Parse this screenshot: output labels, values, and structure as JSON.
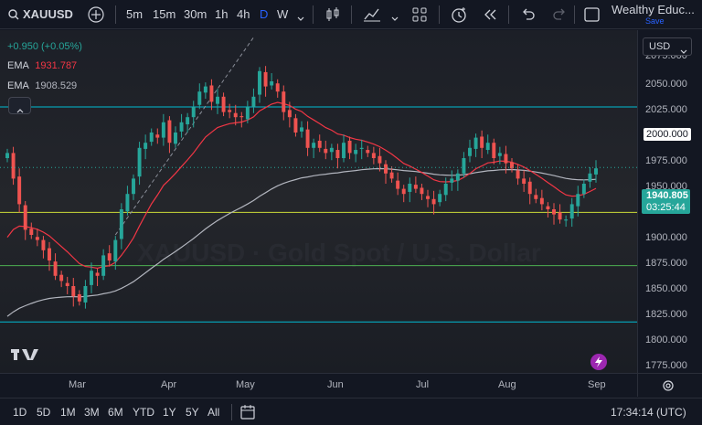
{
  "toolbar": {
    "symbol": "XAUUSD",
    "add_symbol_icon": "plus-circle-icon",
    "timeframes": [
      "5m",
      "15m",
      "30m",
      "1h",
      "4h",
      "D",
      "W"
    ],
    "active_timeframe": "D",
    "account_name": "Wealthy Educ...",
    "save_label": "Save"
  },
  "legend": {
    "change": "+0.950 (+0.05%)",
    "ema1_label": "EMA",
    "ema1_value": "1931.787",
    "ema2_label": "EMA",
    "ema2_value": "1908.529",
    "collapse_icon": "chevron-up-icon"
  },
  "currency": "USD",
  "price_axis": {
    "top_partial": "2075.000",
    "ticks": [
      "2050.000",
      "2025.000",
      "2000.000",
      "1975.000",
      "1950.000",
      "1925.000",
      "1900.000",
      "1875.000",
      "1850.000",
      "1825.000",
      "1800.000",
      "1775.000"
    ],
    "current_price": "1940.805",
    "countdown": "03:25:44",
    "level_label": "2000.000"
  },
  "time_axis": {
    "ticks": [
      "Mar",
      "Apr",
      "May",
      "Jun",
      "Jul",
      "Aug",
      "Sep"
    ]
  },
  "watermark": "XAUUSD · Gold Spot / U.S. Dollar",
  "ranges": [
    "1D",
    "5D",
    "1M",
    "3M",
    "6M",
    "YTD",
    "1Y",
    "5Y",
    "All"
  ],
  "clock": "17:34:14 (UTC)",
  "colors": {
    "up": "#26a69a",
    "down": "#ef5350",
    "ema_fast": "#f23645",
    "ema_slow": "#b2b5be",
    "level_cyan": "#00bcd4",
    "level_green": "#4caf50",
    "level_yellowgreen": "#cddc39",
    "accent": "#2962ff"
  },
  "chart_data": {
    "type": "candlestick",
    "symbol": "XAUUSD",
    "interval": "D",
    "ylim": [
      1775,
      2075
    ],
    "price_levels": [
      {
        "value": 2000,
        "color": "cyan"
      },
      {
        "value": 1897,
        "color": "yellowgreen"
      },
      {
        "value": 1845,
        "color": "green"
      },
      {
        "value": 1790,
        "color": "cyan"
      }
    ],
    "trend_line": {
      "from": [
        "Mid Feb",
        1875
      ],
      "to": [
        "Early May",
        2068
      ],
      "style": "dashed"
    },
    "closes": [
      1955,
      1930,
      1905,
      1880,
      1875,
      1870,
      1860,
      1850,
      1835,
      1830,
      1825,
      1815,
      1810,
      1825,
      1840,
      1835,
      1855,
      1850,
      1870,
      1900,
      1915,
      1930,
      1960,
      1965,
      1975,
      1970,
      1985,
      1965,
      1975,
      1985,
      1990,
      2000,
      2015,
      2020,
      2005,
      2010,
      1995,
      1995,
      1990,
      1990,
      2000,
      2010,
      2035,
      2020,
      2025,
      2015,
      1995,
      1990,
      1975,
      1980,
      1960,
      1965,
      1960,
      1955,
      1960,
      1950,
      1965,
      1955,
      1958,
      1960,
      1955,
      1950,
      1945,
      1935,
      1930,
      1920,
      1915,
      1925,
      1920,
      1915,
      1910,
      1905,
      1915,
      1925,
      1930,
      1935,
      1950,
      1960,
      1970,
      1960,
      1965,
      1950,
      1955,
      1945,
      1940,
      1930,
      1925,
      1915,
      1910,
      1905,
      1900,
      1895,
      1890,
      1890,
      1905,
      1915,
      1925,
      1935,
      1940
    ],
    "ema_fast_last": 1931.787,
    "ema_slow_last": 1908.529,
    "last_price": 1940.805
  }
}
